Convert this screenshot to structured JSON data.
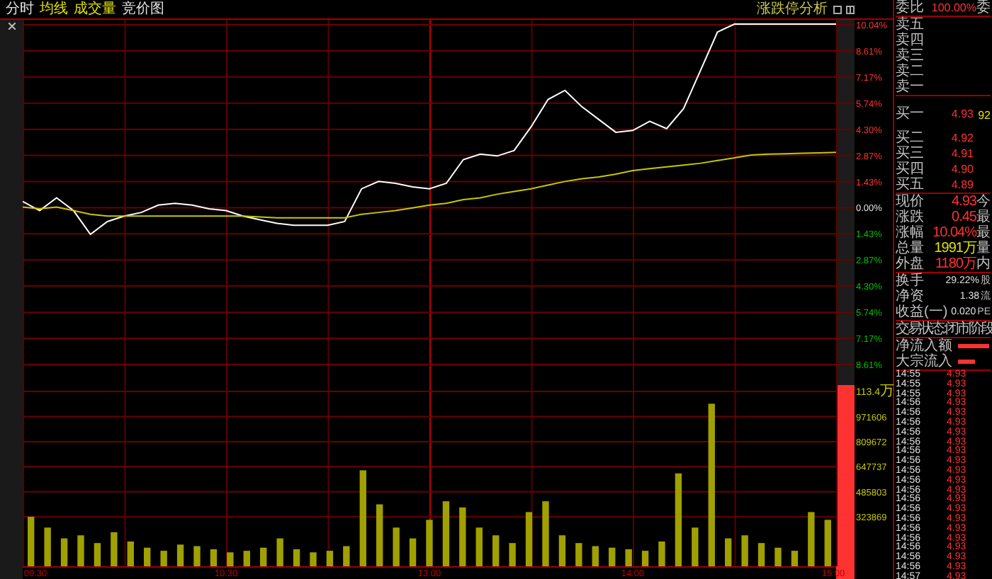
{
  "header": {
    "tabs": [
      {
        "label": "分时",
        "kind": "view"
      },
      {
        "label": "均线",
        "kind": "indicator"
      },
      {
        "label": "成交量",
        "kind": "indicator"
      },
      {
        "label": "竞价图",
        "kind": "view"
      }
    ],
    "analysis_button": "涨跌停分析"
  },
  "price_chart": {
    "chart_data": {
      "type": "line",
      "series": [
        {
          "color": "#ffffff",
          "values": [
            0.3,
            -0.2,
            0.5,
            -0.2,
            -1.5,
            -0.8,
            -0.5,
            -0.3,
            0.1,
            0.2,
            0.1,
            -0.1,
            -0.2,
            -0.5,
            -0.7,
            -0.9,
            -1.0,
            -1.0,
            -1.0,
            -0.8,
            1.0,
            1.4,
            1.3,
            1.1,
            1.0,
            1.3,
            2.6,
            2.9,
            2.8,
            3.1,
            4.4,
            5.9,
            6.4,
            5.5,
            4.8,
            4.1,
            4.2,
            4.7,
            4.3,
            5.4,
            7.5,
            9.6,
            10.04,
            10.04,
            10.04,
            10.04,
            10.04,
            10.04,
            10.04
          ]
        },
        {
          "color": "#c8c800",
          "values": [
            0,
            -0.1,
            0,
            -0.2,
            -0.4,
            -0.5,
            -0.5,
            -0.5,
            -0.5,
            -0.5,
            -0.5,
            -0.5,
            -0.5,
            -0.5,
            -0.55,
            -0.6,
            -0.6,
            -0.6,
            -0.6,
            -0.6,
            -0.4,
            -0.3,
            -0.2,
            -0.05,
            0.1,
            0.2,
            0.4,
            0.5,
            0.7,
            0.85,
            1.0,
            1.2,
            1.4,
            1.55,
            1.65,
            1.8,
            2.0,
            2.1,
            2.2,
            2.3,
            2.4,
            2.55,
            2.7,
            2.85,
            2.9,
            2.92,
            2.95,
            2.97,
            3.0
          ]
        }
      ],
      "ylim": [
        -8.61,
        10.04
      ],
      "grid": true,
      "yticks": [
        {
          "value": 10.04,
          "label": "10.04%"
        },
        {
          "value": 8.61,
          "label": "8.61%"
        },
        {
          "value": 7.17,
          "label": "7.17%"
        },
        {
          "value": 5.74,
          "label": "5.74%"
        },
        {
          "value": 4.3,
          "label": "4.30%"
        },
        {
          "value": 2.87,
          "label": "2.87%"
        },
        {
          "value": 1.43,
          "label": "1.43%"
        },
        {
          "value": 0,
          "label": "0.00%"
        },
        {
          "value": -1.43,
          "label": "1.43%"
        },
        {
          "value": -2.87,
          "label": "2.87%"
        },
        {
          "value": -4.3,
          "label": "4.30%"
        },
        {
          "value": -5.74,
          "label": "5.74%"
        },
        {
          "value": -7.17,
          "label": "7.17%"
        },
        {
          "value": -8.61,
          "label": "8.61%"
        }
      ]
    }
  },
  "volume_chart": {
    "top_label": "113.4万",
    "chart_data": {
      "type": "bar",
      "categories": [
        "09:30",
        null,
        null,
        null,
        null,
        null,
        null,
        null,
        null,
        null,
        null,
        null,
        "10:30",
        null,
        null,
        null,
        null,
        null,
        null,
        null,
        null,
        null,
        null,
        null,
        "13:00",
        null,
        null,
        null,
        null,
        null,
        null,
        null,
        null,
        null,
        null,
        null,
        "14:00",
        null,
        null,
        null,
        null,
        null,
        null,
        null,
        null,
        null,
        null,
        null,
        "15:00"
      ],
      "series": [
        {
          "color": "#a0a000",
          "values": [
            320000,
            250000,
            180000,
            200000,
            150000,
            220000,
            160000,
            120000,
            100000,
            140000,
            130000,
            110000,
            90000,
            100000,
            120000,
            180000,
            110000,
            90000,
            100000,
            130000,
            620000,
            400000,
            250000,
            180000,
            300000,
            420000,
            380000,
            250000,
            200000,
            150000,
            350000,
            420000,
            200000,
            150000,
            130000,
            120000,
            110000,
            100000,
            160000,
            600000,
            250000,
            1050000,
            180000,
            200000,
            150000,
            120000,
            100000,
            350000,
            300000
          ]
        }
      ],
      "ylim": [
        0,
        1134000
      ],
      "grid": true,
      "yticks": [
        {
          "value": 971606,
          "label": "971606"
        },
        {
          "value": 809672,
          "label": "809672"
        },
        {
          "value": 647737,
          "label": "647737"
        },
        {
          "value": 485803,
          "label": "485803"
        },
        {
          "value": 323869,
          "label": "323869"
        }
      ]
    }
  },
  "quote_panel": {
    "ratio": {
      "label": "委比",
      "value": "100.00%",
      "extra": "委"
    },
    "asks": [
      {
        "label": "卖五"
      },
      {
        "label": "卖四"
      },
      {
        "label": "卖三"
      },
      {
        "label": "卖二"
      },
      {
        "label": "卖一"
      }
    ],
    "bids": [
      {
        "label": "买一",
        "price": "4.93",
        "volume": "92"
      },
      {
        "label": "买二",
        "price": "4.92"
      },
      {
        "label": "买三",
        "price": "4.91"
      },
      {
        "label": "买四",
        "price": "4.90"
      },
      {
        "label": "买五",
        "price": "4.89"
      }
    ],
    "stats": [
      {
        "label": "现价",
        "value": "4.93",
        "color": "#ff3232",
        "extra": "今"
      },
      {
        "label": "涨跌",
        "value": "0.45",
        "color": "#ff3232",
        "extra": "最"
      },
      {
        "label": "涨幅",
        "value": "10.04%",
        "color": "#ff3232",
        "extra": "最"
      },
      {
        "label": "总量",
        "value": "1991万",
        "color": "#e0e000",
        "extra": "量"
      },
      {
        "label": "外盘",
        "value": "1180万",
        "color": "#ff3232",
        "extra": "内"
      }
    ],
    "fundamentals": [
      {
        "label": "换手",
        "value": "29.22%",
        "extra": "股"
      },
      {
        "label": "净资",
        "value": "1.38",
        "extra": "流"
      },
      {
        "label": "收益(一)",
        "value": "0.020",
        "extra": "PE"
      }
    ],
    "status": "交易状态:闭市阶段",
    "flows": [
      {
        "label": "净流入额"
      },
      {
        "label": "大宗流入"
      }
    ],
    "ticks": [
      {
        "time": "14:55",
        "price": "4.93"
      },
      {
        "time": "14:55",
        "price": "4.93"
      },
      {
        "time": "14:55",
        "price": "4.93"
      },
      {
        "time": "14:56",
        "price": "4.93"
      },
      {
        "time": "14:56",
        "price": "4.93"
      },
      {
        "time": "14:56",
        "price": "4.93"
      },
      {
        "time": "14:56",
        "price": "4.93"
      },
      {
        "time": "14:56",
        "price": "4.93"
      },
      {
        "time": "14:56",
        "price": "4.93"
      },
      {
        "time": "14:56",
        "price": "4.93"
      },
      {
        "time": "14:56",
        "price": "4.93"
      },
      {
        "time": "14:56",
        "price": "4.93"
      },
      {
        "time": "14:56",
        "price": "4.93"
      },
      {
        "time": "14:56",
        "price": "4.93"
      },
      {
        "time": "14:56",
        "price": "4.93"
      },
      {
        "time": "14:56",
        "price": "4.93"
      },
      {
        "time": "14:56",
        "price": "4.93"
      },
      {
        "time": "14:56",
        "price": "4.93"
      },
      {
        "time": "14:56",
        "price": "4.93"
      },
      {
        "time": "14:56",
        "price": "4.93"
      },
      {
        "time": "14:56",
        "price": "4.93"
      },
      {
        "time": "14:57",
        "price": "4.93"
      }
    ]
  }
}
